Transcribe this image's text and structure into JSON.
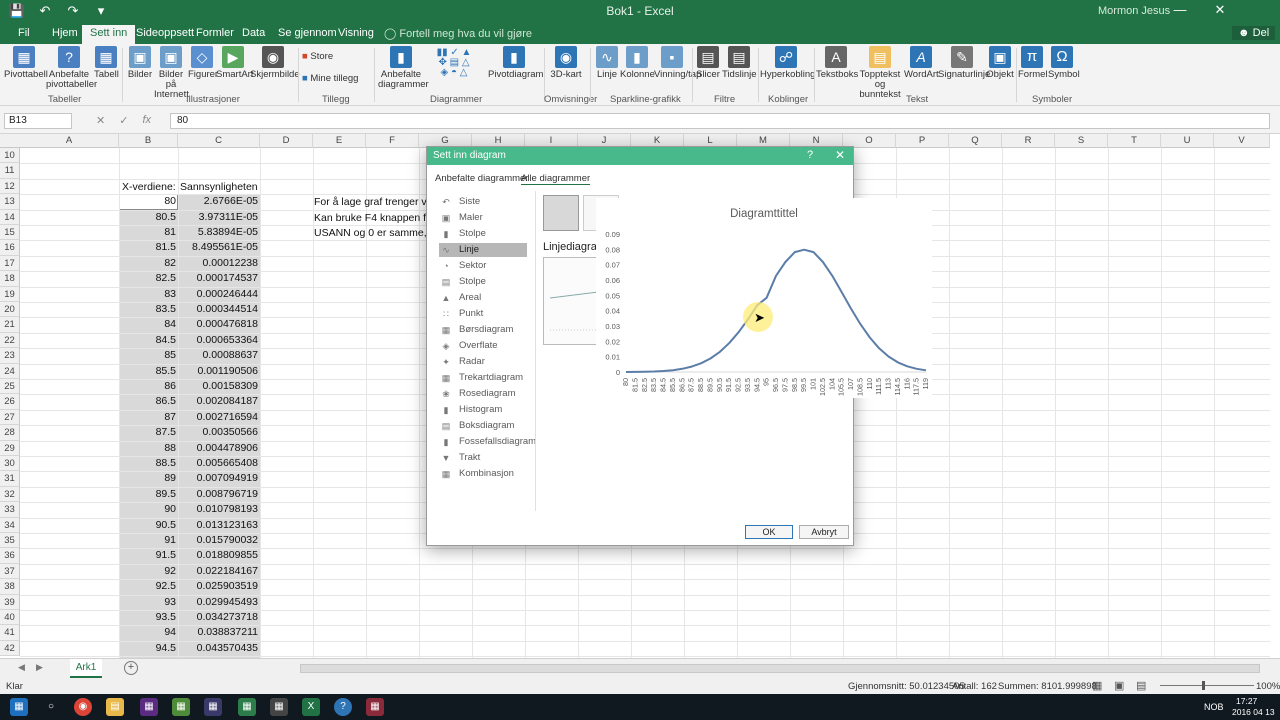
{
  "window": {
    "title": "Bok1 - Excel",
    "user": "Mormon Jesus",
    "qat_icons": [
      "save-icon",
      "undo-icon",
      "redo-icon",
      "customize-icon"
    ]
  },
  "tabs": [
    "Fil",
    "Hjem",
    "Sett inn",
    "Sideoppsett",
    "Formler",
    "Data",
    "Se gjennom",
    "Visning"
  ],
  "active_tab": "Sett inn",
  "tell_me": "Fortell meg hva du vil gjøre",
  "share": "Del",
  "ribbon": {
    "buttons": [
      {
        "label": "Pivottabell",
        "icon": "pivottable-icon"
      },
      {
        "label": "Anbefalte pivottabeller",
        "icon": "recommended-pivot-icon"
      },
      {
        "label": "Tabell",
        "icon": "table-icon"
      },
      {
        "label": "Bilder",
        "icon": "pictures-icon"
      },
      {
        "label": "Bilder på Internett",
        "icon": "online-pictures-icon"
      },
      {
        "label": "Figurer",
        "icon": "shapes-icon"
      },
      {
        "label": "SmartArt",
        "icon": "smartart-icon"
      },
      {
        "label": "Skjermbilde",
        "icon": "screenshot-icon"
      },
      {
        "label": "Store",
        "icon": "store-icon"
      },
      {
        "label": "Mine tillegg",
        "icon": "addins-icon"
      },
      {
        "label": "Anbefalte diagrammer",
        "icon": "recommended-charts-icon"
      },
      {
        "label": "Pivotdiagram",
        "icon": "pivotchart-icon"
      },
      {
        "label": "3D-kart",
        "icon": "3dmap-icon"
      },
      {
        "label": "Linje",
        "icon": "sparkline-line-icon"
      },
      {
        "label": "Kolonne",
        "icon": "sparkline-column-icon"
      },
      {
        "label": "Vinning/tap",
        "icon": "sparkline-winloss-icon"
      },
      {
        "label": "Slicer",
        "icon": "slicer-icon"
      },
      {
        "label": "Tidslinje",
        "icon": "timeline-icon"
      },
      {
        "label": "Hyperkobling",
        "icon": "hyperlink-icon"
      },
      {
        "label": "Tekstboks",
        "icon": "textbox-icon"
      },
      {
        "label": "Topptekst og bunntekst",
        "icon": "header-footer-icon"
      },
      {
        "label": "WordArt",
        "icon": "wordart-icon"
      },
      {
        "label": "Signaturlinje",
        "icon": "signature-icon"
      },
      {
        "label": "Objekt",
        "icon": "object-icon"
      },
      {
        "label": "Formel",
        "icon": "equation-icon"
      },
      {
        "label": "Symbol",
        "icon": "symbol-icon"
      }
    ],
    "groups": [
      "Tabeller",
      "Illustrasjoner",
      "Tillegg",
      "Diagrammer",
      "Omvisninger",
      "Sparkline-grafikk",
      "Filtre",
      "Koblinger",
      "Tekst",
      "Symboler"
    ]
  },
  "formula_bar": {
    "namebox": "B13",
    "formula": "80",
    "fx": "fx"
  },
  "columns": [
    "A",
    "B",
    "C",
    "D",
    "E",
    "F",
    "G",
    "H",
    "I",
    "J",
    "K",
    "L",
    "M",
    "N",
    "O",
    "P",
    "Q",
    "R",
    "S",
    "T",
    "U",
    "V"
  ],
  "rows": [
    "10",
    "11",
    "12",
    "13",
    "14",
    "15",
    "16",
    "17",
    "18",
    "19",
    "20",
    "21",
    "22",
    "23",
    "24",
    "25",
    "26",
    "27",
    "28",
    "29",
    "30",
    "31",
    "32",
    "33",
    "34",
    "35",
    "36",
    "37",
    "38",
    "39",
    "40",
    "41",
    "42"
  ],
  "headers": {
    "b": "X-verdiene:",
    "c": "Sannsynligheten"
  },
  "data_rows": [
    {
      "x": "80",
      "p": "2.6766E-05"
    },
    {
      "x": "80.5",
      "p": "3.97311E-05"
    },
    {
      "x": "81",
      "p": "5.83894E-05"
    },
    {
      "x": "81.5",
      "p": "8.495561E-05"
    },
    {
      "x": "82",
      "p": "0.00012238"
    },
    {
      "x": "82.5",
      "p": "0.000174537"
    },
    {
      "x": "83",
      "p": "0.000246444"
    },
    {
      "x": "83.5",
      "p": "0.000344514"
    },
    {
      "x": "84",
      "p": "0.000476818"
    },
    {
      "x": "84.5",
      "p": "0.000653364"
    },
    {
      "x": "85",
      "p": "0.00088637"
    },
    {
      "x": "85.5",
      "p": "0.001190506"
    },
    {
      "x": "86",
      "p": "0.00158309"
    },
    {
      "x": "86.5",
      "p": "0.002084187"
    },
    {
      "x": "87",
      "p": "0.002716594"
    },
    {
      "x": "87.5",
      "p": "0.00350566"
    },
    {
      "x": "88",
      "p": "0.004478906"
    },
    {
      "x": "88.5",
      "p": "0.005665408"
    },
    {
      "x": "89",
      "p": "0.007094919"
    },
    {
      "x": "89.5",
      "p": "0.008796719"
    },
    {
      "x": "90",
      "p": "0.010798193"
    },
    {
      "x": "90.5",
      "p": "0.013123163"
    },
    {
      "x": "91",
      "p": "0.015790032"
    },
    {
      "x": "91.5",
      "p": "0.018809855"
    },
    {
      "x": "92",
      "p": "0.022184167"
    },
    {
      "x": "92.5",
      "p": "0.025903519"
    },
    {
      "x": "93",
      "p": "0.029945493"
    },
    {
      "x": "93.5",
      "p": "0.034273718"
    },
    {
      "x": "94",
      "p": "0.038837211"
    },
    {
      "x": "94.5",
      "p": "0.043570435"
    }
  ],
  "notes": [
    "For å lage graf trenger v",
    "Kan bruke F4 knappen fo",
    "USANN og 0 er samme,"
  ],
  "sheet": {
    "tab": "Ark1"
  },
  "status": {
    "ready": "Klar",
    "average": "Gjennomsnitt: 50.01234505",
    "count": "Antall: 162",
    "sum": "Summen: 8101.999898",
    "zoom": "100%"
  },
  "taskbar": {
    "lang": "NOB",
    "time": "17:27",
    "date": "2016 04 13"
  },
  "dialog": {
    "title": "Sett inn diagram",
    "tabs": [
      "Anbefalte diagrammer",
      "Alle diagrammer"
    ],
    "chart_types": [
      "Siste",
      "Maler",
      "Stolpe",
      "Linje",
      "Sektor",
      "Stolpe",
      "Areal",
      "Punkt",
      "Børsdiagram",
      "Overflate",
      "Radar",
      "Trekartdiagram",
      "Rosediagram",
      "Histogram",
      "Boksdiagram",
      "Fossefallsdiagram",
      "Trakt",
      "Kombinasjon"
    ],
    "selected_type": "Linje",
    "subtype_label": "Linjediagram",
    "ok": "OK",
    "cancel": "Avbryt"
  },
  "chart_data": {
    "type": "line",
    "title": "Diagramttittel",
    "x": [
      80,
      81.5,
      82.5,
      83.5,
      84.5,
      85.5,
      86.5,
      87.5,
      88.5,
      89.5,
      90.5,
      91.5,
      92.5,
      93.5,
      94.5,
      95,
      96.5,
      97.5,
      98.5,
      99.5,
      101,
      102.5,
      104,
      105.5,
      107,
      108.5,
      110,
      111.5,
      113,
      114.5,
      116,
      117.5,
      119
    ],
    "x_tick_labels": [
      "80",
      "81.5",
      "82.5",
      "83.5",
      "84.5",
      "85.5",
      "86.5",
      "87.5",
      "88.5",
      "89.5",
      "90.5",
      "91.5",
      "92.5",
      "93.5",
      "94.5",
      "95",
      "96.5",
      "97.5",
      "98.5",
      "99.5",
      "101",
      "102.5",
      "104",
      "105.5",
      "107",
      "108.5",
      "110",
      "111.5",
      "113",
      "114.5",
      "116",
      "117.5",
      "119"
    ],
    "y_tick_labels": [
      "0",
      "0.01",
      "0.02",
      "0.03",
      "0.04",
      "0.05",
      "0.06",
      "0.07",
      "0.08",
      "0.09"
    ],
    "ylim": [
      0,
      0.09
    ],
    "mean": 100,
    "sd": 5,
    "series": [
      {
        "values": [
          3e-05,
          8e-05,
          0.00017,
          0.00034,
          0.00065,
          0.00119,
          0.00208,
          0.00351,
          0.00567,
          0.0088,
          0.01312,
          0.01881,
          0.0259,
          0.03427,
          0.04357,
          0.04839,
          0.06271,
          0.07175,
          0.07821,
          0.07978,
          0.07821,
          0.07175,
          0.06271,
          0.05218,
          0.04137,
          0.03127,
          0.02252,
          0.01545,
          0.0101,
          0.00629,
          0.00373,
          0.00211,
          0.00114
        ]
      }
    ],
    "color": "#5b7ea8"
  }
}
